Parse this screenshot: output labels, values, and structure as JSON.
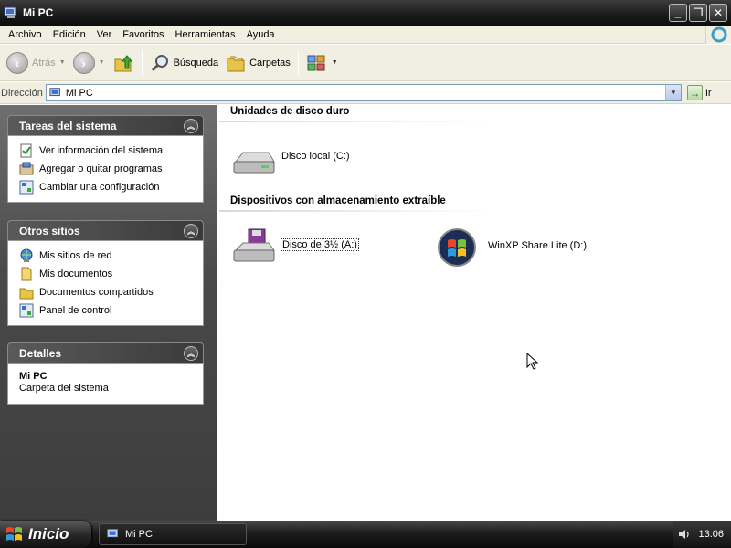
{
  "window": {
    "title": "Mi PC"
  },
  "menu": [
    "Archivo",
    "Edición",
    "Ver",
    "Favoritos",
    "Herramientas",
    "Ayuda"
  ],
  "toolbar": {
    "back_label": "Atrás",
    "search_label": "Búsqueda",
    "folders_label": "Carpetas"
  },
  "address": {
    "label": "Dirección",
    "value": "Mi PC",
    "go_label": "Ir"
  },
  "panels": {
    "system_tasks": {
      "title": "Tareas del sistema",
      "items": [
        "Ver información del sistema",
        "Agregar o quitar programas",
        "Cambiar una configuración"
      ]
    },
    "other_places": {
      "title": "Otros sitios",
      "items": [
        "Mis sitios de red",
        "Mis documentos",
        "Documentos compartidos",
        "Panel de control"
      ]
    },
    "details": {
      "title": "Detalles",
      "name": "Mi PC",
      "description": "Carpeta del sistema"
    }
  },
  "content": {
    "hard_drives_header": "Unidades de disco duro",
    "local_disk": "Disco local (C:)",
    "removable_header": "Dispositivos con almacenamiento extraíble",
    "floppy": "Disco de 3½ (A:)",
    "cd_drive": "WinXP Share Lite (D:)"
  },
  "taskbar": {
    "start_label": "Inicio",
    "window_button": "Mi PC",
    "clock": "13:06"
  },
  "colors": {
    "accent_dark": "#1a1a1a",
    "panel_bg": "#4a4a4a",
    "chrome_bg": "#f1efe2"
  }
}
